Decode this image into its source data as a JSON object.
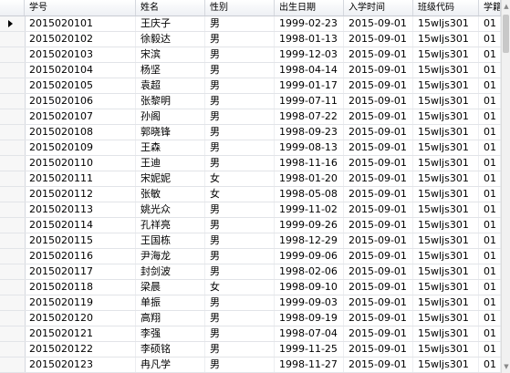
{
  "columns": [
    "学号",
    "姓名",
    "性别",
    "出生日期",
    "入学时间",
    "班级代码",
    "学籍状态"
  ],
  "rows": [
    [
      "2015020101",
      "王庆子",
      "男",
      "1999-02-23",
      "2015-09-01",
      "15wljs301",
      "01"
    ],
    [
      "2015020102",
      "徐毅达",
      "男",
      "1998-01-13",
      "2015-09-01",
      "15wljs301",
      "01"
    ],
    [
      "2015020103",
      "宋滨",
      "男",
      "1999-12-03",
      "2015-09-01",
      "15wljs301",
      "01"
    ],
    [
      "2015020104",
      "杨坚",
      "男",
      "1998-04-14",
      "2015-09-01",
      "15wljs301",
      "01"
    ],
    [
      "2015020105",
      "袁超",
      "男",
      "1999-01-17",
      "2015-09-01",
      "15wljs301",
      "01"
    ],
    [
      "2015020106",
      "张黎明",
      "男",
      "1999-07-11",
      "2015-09-01",
      "15wljs301",
      "01"
    ],
    [
      "2015020107",
      "孙阁",
      "男",
      "1998-07-22",
      "2015-09-01",
      "15wljs301",
      "01"
    ],
    [
      "2015020108",
      "郭晓锋",
      "男",
      "1998-09-23",
      "2015-09-01",
      "15wljs301",
      "01"
    ],
    [
      "2015020109",
      "王森",
      "男",
      "1999-08-13",
      "2015-09-01",
      "15wljs301",
      "01"
    ],
    [
      "2015020110",
      "王迪",
      "男",
      "1998-11-16",
      "2015-09-01",
      "15wljs301",
      "01"
    ],
    [
      "2015020111",
      "宋妮妮",
      "女",
      "1998-01-20",
      "2015-09-01",
      "15wljs301",
      "01"
    ],
    [
      "2015020112",
      "张敏",
      "女",
      "1998-05-08",
      "2015-09-01",
      "15wljs301",
      "01"
    ],
    [
      "2015020113",
      "姚光众",
      "男",
      "1999-11-02",
      "2015-09-01",
      "15wljs301",
      "01"
    ],
    [
      "2015020114",
      "孔祥亮",
      "男",
      "1999-09-26",
      "2015-09-01",
      "15wljs301",
      "01"
    ],
    [
      "2015020115",
      "王国栋",
      "男",
      "1998-12-29",
      "2015-09-01",
      "15wljs301",
      "01"
    ],
    [
      "2015020116",
      "尹海龙",
      "男",
      "1999-09-06",
      "2015-09-01",
      "15wljs301",
      "01"
    ],
    [
      "2015020117",
      "封剑波",
      "男",
      "1998-02-06",
      "2015-09-01",
      "15wljs301",
      "01"
    ],
    [
      "2015020118",
      "梁晨",
      "女",
      "1998-09-10",
      "2015-09-01",
      "15wljs301",
      "01"
    ],
    [
      "2015020119",
      "单振",
      "男",
      "1999-09-03",
      "2015-09-01",
      "15wljs301",
      "01"
    ],
    [
      "2015020120",
      "高翔",
      "男",
      "1998-09-19",
      "2015-09-01",
      "15wljs301",
      "01"
    ],
    [
      "2015020121",
      "李强",
      "男",
      "1998-07-04",
      "2015-09-01",
      "15wljs301",
      "01"
    ],
    [
      "2015020122",
      "李硕铭",
      "男",
      "1999-11-25",
      "2015-09-01",
      "15wljs301",
      "01"
    ],
    [
      "2015020123",
      "冉凡学",
      "男",
      "1998-11-27",
      "2015-09-01",
      "15wljs301",
      "01"
    ]
  ]
}
